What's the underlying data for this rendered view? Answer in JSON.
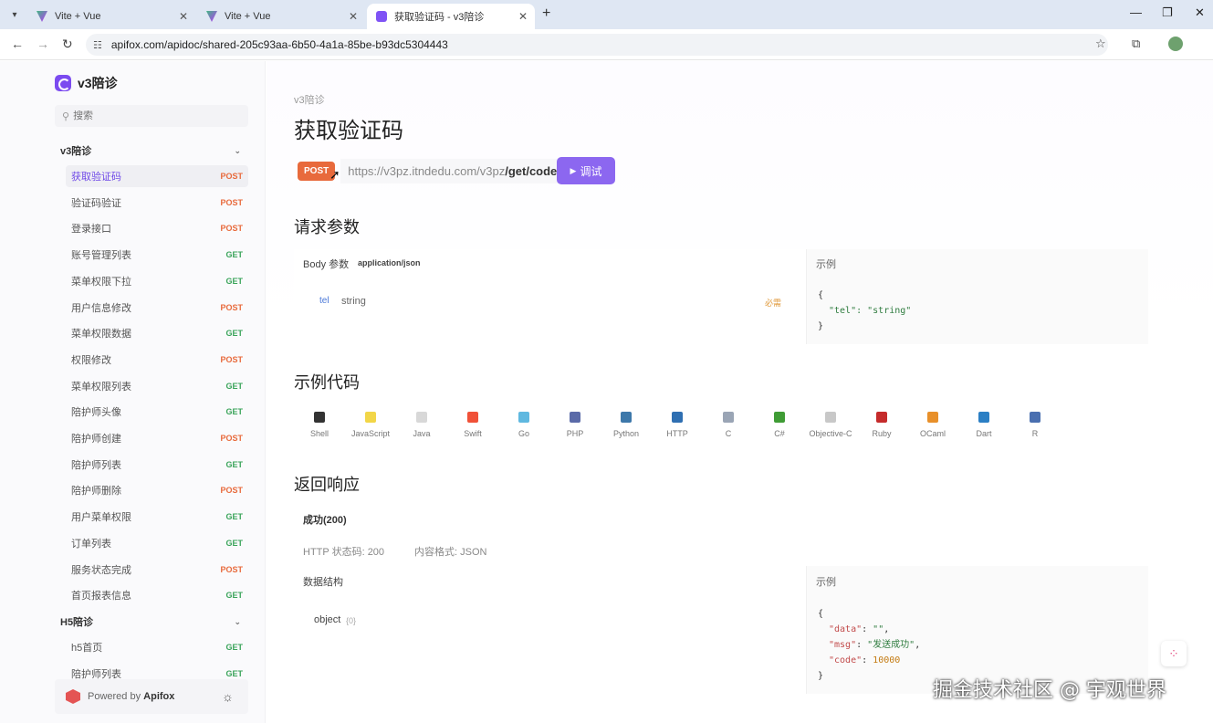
{
  "browser": {
    "tabs": [
      {
        "title": "Vite + Vue"
      },
      {
        "title": "Vite + Vue"
      },
      {
        "title": "获取验证码 - v3陪诊"
      }
    ],
    "url": "apifox.com/apidoc/shared-205c93aa-6b50-4a1a-85be-b93dc5304443"
  },
  "sidebar": {
    "brand": "v3陪诊",
    "search_placeholder": "搜索",
    "groups": [
      {
        "label": "v3陪诊"
      },
      {
        "label": "H5陪诊"
      }
    ],
    "items": [
      {
        "label": "获取验证码",
        "method": "POST"
      },
      {
        "label": "验证码验证",
        "method": "POST"
      },
      {
        "label": "登录接口",
        "method": "POST"
      },
      {
        "label": "账号管理列表",
        "method": "GET"
      },
      {
        "label": "菜单权限下拉",
        "method": "GET"
      },
      {
        "label": "用户信息修改",
        "method": "POST"
      },
      {
        "label": "菜单权限数据",
        "method": "GET"
      },
      {
        "label": "权限修改",
        "method": "POST"
      },
      {
        "label": "菜单权限列表",
        "method": "GET"
      },
      {
        "label": "陪护师头像",
        "method": "GET"
      },
      {
        "label": "陪护师创建",
        "method": "POST"
      },
      {
        "label": "陪护师列表",
        "method": "GET"
      },
      {
        "label": "陪护师删除",
        "method": "POST"
      },
      {
        "label": "用户菜单权限",
        "method": "GET"
      },
      {
        "label": "订单列表",
        "method": "GET"
      },
      {
        "label": "服务状态完成",
        "method": "POST"
      },
      {
        "label": "首页报表信息",
        "method": "GET"
      }
    ],
    "h5_items": [
      {
        "label": "h5首页",
        "method": "GET"
      },
      {
        "label": "陪护师列表",
        "method": "GET"
      }
    ],
    "footer_prefix": "Powered by",
    "footer_brand": "Apifox"
  },
  "main": {
    "breadcrumb": "v3陪诊",
    "title": "获取验证码",
    "method": "POST",
    "url_base": "https://v3pz.itndedu.com/v3pz",
    "url_path": "/get/code",
    "debug_button": "调试",
    "request_heading": "请求参数",
    "body_label": "Body 参数",
    "content_type": "application/json",
    "param_name": "tel",
    "param_type": "string",
    "param_required": "必需",
    "example_label": "示例",
    "request_example": [
      "{",
      "\"tel\": \"string\"",
      "}"
    ],
    "code_heading": "示例代码",
    "languages": [
      {
        "name": "Shell",
        "color": "#333333"
      },
      {
        "name": "JavaScript",
        "color": "#f2d648"
      },
      {
        "name": "Java",
        "color": "#d8d8d8"
      },
      {
        "name": "Swift",
        "color": "#f05138"
      },
      {
        "name": "Go",
        "color": "#5fb8e0"
      },
      {
        "name": "PHP",
        "color": "#5a6aa8"
      },
      {
        "name": "Python",
        "color": "#3d78aa"
      },
      {
        "name": "HTTP",
        "color": "#2f6fb2"
      },
      {
        "name": "C",
        "color": "#9aa5b5"
      },
      {
        "name": "C#",
        "color": "#3f9c35"
      },
      {
        "name": "Objective-C",
        "color": "#c8c8c8"
      },
      {
        "name": "Ruby",
        "color": "#c52b2b"
      },
      {
        "name": "OCaml",
        "color": "#e8902a"
      },
      {
        "name": "Dart",
        "color": "#2b7fc4"
      },
      {
        "name": "R",
        "color": "#4a6fb0"
      }
    ],
    "response_heading": "返回响应",
    "response_status": "成功(200)",
    "http_status": "HTTP 状态码: 200",
    "content_format": "内容格式: JSON",
    "schema_label": "数据结构",
    "schema_type": "object",
    "schema_count": "{0}",
    "response_example": {
      "data_key": "\"data\"",
      "data_val": "\"\"",
      "msg_key": "\"msg\"",
      "msg_val": "\"发送成功\"",
      "code_key": "\"code\"",
      "code_val": "10000"
    }
  },
  "watermark": "掘金技术社区 @ 宇观世界"
}
